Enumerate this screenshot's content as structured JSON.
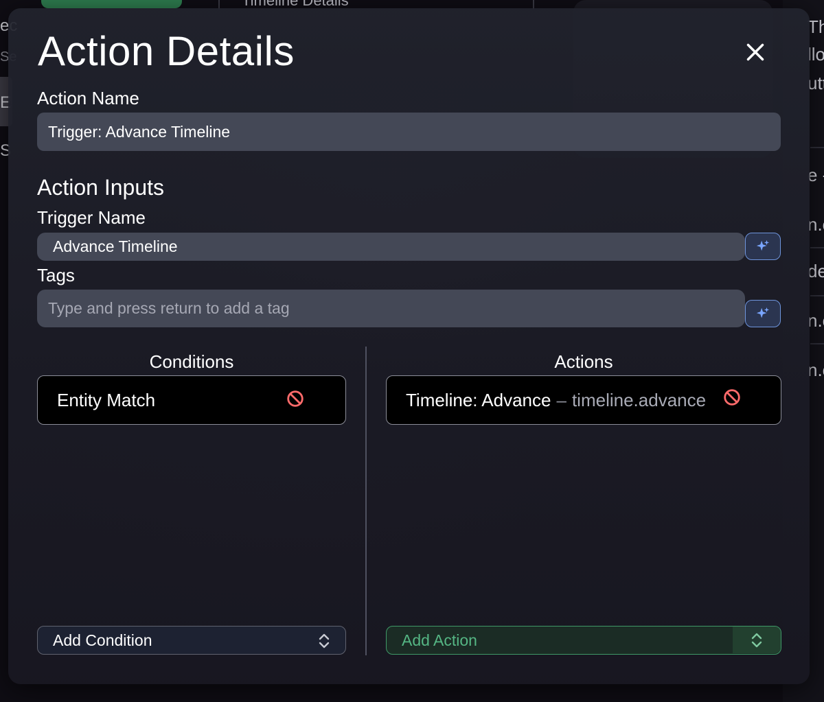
{
  "modal": {
    "title": "Action Details",
    "action_name_label": "Action Name",
    "action_name_value": "Trigger: Advance Timeline",
    "inputs_heading": "Action Inputs",
    "trigger_name_label": "Trigger Name",
    "trigger_name_value": "Advance Timeline",
    "tags_label": "Tags",
    "tags_placeholder": "Type and press return to add a tag",
    "conditions": {
      "heading": "Conditions",
      "items": [
        {
          "label": "Entity Match"
        }
      ],
      "add_label": "Add Condition"
    },
    "actions": {
      "heading": "Actions",
      "items": [
        {
          "label": "Timeline: Advance",
          "separator": "–",
          "id": "timeline.advance"
        }
      ],
      "add_label": "Add Action"
    }
  },
  "background": {
    "top_title": "Timeline Details",
    "left_fragments": [
      "ec",
      "Se",
      "E",
      "S"
    ],
    "right_fragments": [
      "Th",
      "llo",
      "utt",
      "e -",
      "n.c",
      "de",
      "n.c",
      "n.c"
    ]
  },
  "icons": {
    "close": "close-icon",
    "sparkle": "sparkle-icon",
    "remove": "no-entry-icon",
    "select": "chevron-up-down-icon"
  },
  "colors": {
    "accent_blue": "#6f95dd",
    "remove_red": "#ff6b6b",
    "action_green": "#55b684"
  }
}
